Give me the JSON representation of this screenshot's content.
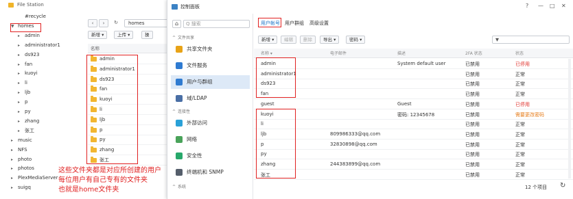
{
  "file_station": {
    "title": "File Station",
    "tree": [
      {
        "label": "#recycle",
        "expanded": null,
        "indent": 2
      },
      {
        "label": "homes",
        "expanded": true,
        "indent": 1
      },
      {
        "label": "admin",
        "expanded": false,
        "indent": 2
      },
      {
        "label": "administrator1",
        "expanded": false,
        "indent": 2
      },
      {
        "label": "ds923",
        "expanded": false,
        "indent": 2
      },
      {
        "label": "fan",
        "expanded": false,
        "indent": 2
      },
      {
        "label": "kuoyi",
        "expanded": false,
        "indent": 2
      },
      {
        "label": "li",
        "expanded": false,
        "indent": 2
      },
      {
        "label": "ljb",
        "expanded": false,
        "indent": 2
      },
      {
        "label": "p",
        "expanded": false,
        "indent": 2
      },
      {
        "label": "py",
        "expanded": false,
        "indent": 2
      },
      {
        "label": "zhang",
        "expanded": false,
        "indent": 2
      },
      {
        "label": "张工",
        "expanded": false,
        "indent": 2
      },
      {
        "label": "music",
        "expanded": false,
        "indent": 1
      },
      {
        "label": "NFS",
        "expanded": false,
        "indent": 1
      },
      {
        "label": "photo",
        "expanded": false,
        "indent": 1
      },
      {
        "label": "photos",
        "expanded": false,
        "indent": 1
      },
      {
        "label": "PlexMediaServer",
        "expanded": false,
        "indent": 1
      },
      {
        "label": "suigq",
        "expanded": false,
        "indent": 1
      }
    ],
    "path": "homes",
    "back_icon": "chevron-left-icon",
    "forward_icon": "chevron-right-icon",
    "refresh_icon": "refresh-icon",
    "toolbar": {
      "new": "新增 ▾",
      "upload": "上传 ▾",
      "action": "操"
    },
    "column_name": "名称",
    "files": [
      "admin",
      "administrator1",
      "ds923",
      "fan",
      "kuoyi",
      "li",
      "ljb",
      "p",
      "py",
      "zhang",
      "张工"
    ],
    "annotation": [
      "这些文件夹都是对应所创建的用户",
      "每位用户有自己专有的文件夹",
      "也就是home文件夹"
    ]
  },
  "control_panel": {
    "title": "控制面板",
    "window_controls": {
      "help": "?",
      "minimize": "—",
      "maximize": "□",
      "close": "✕"
    },
    "home_icon": "home-icon",
    "search_placeholder": "Q 搜索",
    "sidebar": {
      "section_file_sharing": "文件共享",
      "items_top": [
        {
          "label": "共享文件夹",
          "icon": "shared-folder-icon",
          "color": "#e8a317"
        },
        {
          "label": "文件服务",
          "icon": "file-services-icon",
          "color": "#2f7bd1"
        },
        {
          "label": "用户与群组",
          "icon": "users-groups-icon",
          "color": "#2f7bd1",
          "active": true
        },
        {
          "label": "域/LDAP",
          "icon": "domain-ldap-icon",
          "color": "#4a6fa5"
        }
      ],
      "section_connectivity": "连接性",
      "items_bottom": [
        {
          "label": "外部访问",
          "icon": "external-access-icon",
          "color": "#2aa1d8"
        },
        {
          "label": "网络",
          "icon": "network-icon",
          "color": "#4aa35a"
        },
        {
          "label": "安全性",
          "icon": "security-icon",
          "color": "#28a86b"
        },
        {
          "label": "终端机和 SNMP",
          "icon": "terminal-snmp-icon",
          "color": "#555e6b"
        }
      ],
      "section_system": "系统"
    },
    "tabs": {
      "users": "用户帐号",
      "groups": "用户群组",
      "advanced": "高级设置"
    },
    "toolbar": {
      "new": "新增 ▾",
      "edit": "编辑",
      "delete": "删除",
      "export": "导出 ▾",
      "password": "密码 ▾",
      "filter_icon": "filter-icon"
    },
    "columns": {
      "name": "名称 ▾",
      "email": "电子邮件",
      "description": "描述",
      "twofa": "2FA 状态",
      "status": "状态"
    },
    "users": [
      {
        "name": "admin",
        "email": "",
        "description": "System default user",
        "twofa": "已禁用",
        "status": "已停用",
        "status_color": "#e0312b"
      },
      {
        "name": "administrator1",
        "email": "",
        "description": "",
        "twofa": "已禁用",
        "status": "正常",
        "status_color": "#333333"
      },
      {
        "name": "ds923",
        "email": "",
        "description": "",
        "twofa": "已禁用",
        "status": "正常",
        "status_color": "#333333"
      },
      {
        "name": "fan",
        "email": "",
        "description": "",
        "twofa": "已禁用",
        "status": "正常",
        "status_color": "#333333"
      },
      {
        "name": "guest",
        "email": "",
        "description": "Guest",
        "twofa": "已禁用",
        "status": "已停用",
        "status_color": "#e0312b"
      },
      {
        "name": "kuoyi",
        "email": "",
        "description": "密码: 12345678",
        "twofa": "已禁用",
        "status": "需要更改密码",
        "status_color": "#e67a16"
      },
      {
        "name": "li",
        "email": "",
        "description": "",
        "twofa": "已禁用",
        "status": "正常",
        "status_color": "#333333"
      },
      {
        "name": "ljb",
        "email": "809986333@qq.com",
        "description": "",
        "twofa": "已禁用",
        "status": "正常",
        "status_color": "#333333"
      },
      {
        "name": "p",
        "email": "32830898@qq.com",
        "description": "",
        "twofa": "已禁用",
        "status": "正常",
        "status_color": "#333333"
      },
      {
        "name": "py",
        "email": "",
        "description": "",
        "twofa": "已禁用",
        "status": "正常",
        "status_color": "#333333"
      },
      {
        "name": "zhang",
        "email": "244383899@qq.com",
        "description": "",
        "twofa": "已禁用",
        "status": "正常",
        "status_color": "#333333"
      },
      {
        "name": "张工",
        "email": "",
        "description": "",
        "twofa": "已禁用",
        "status": "正常",
        "status_color": "#333333"
      }
    ],
    "item_count": "12 个项目",
    "refresh_icon": "refresh-icon"
  }
}
